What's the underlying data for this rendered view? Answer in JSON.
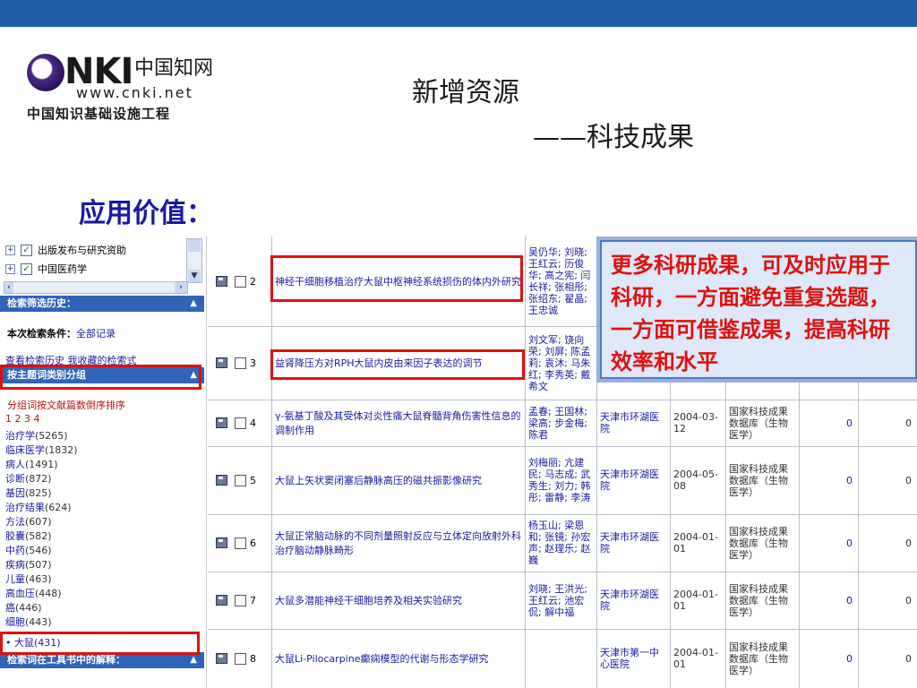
{
  "logo": {
    "brand": "CNKI",
    "cn": "中国知网",
    "url": "www.cnki.net",
    "sub": "中国知识基础设施工程"
  },
  "slide": {
    "title1": "新增资源",
    "title2": "——科技成果",
    "heading": "应用价值：",
    "callout": "更多科研成果，可及时应用于科研，一方面避免重复选题，一方面可借鉴成果，提高科研效率和水平"
  },
  "sidebar": {
    "tree": [
      {
        "label": "出版发布与研究资助"
      },
      {
        "label": "中国医药学"
      }
    ],
    "history_bar": "检索筛选历史：",
    "cond_label": "本次检索条件：",
    "cond_value": "全部记录",
    "history_links": "查看检索历史  我收藏的检索式",
    "group_bar": "按主题词类别分组",
    "sort_text": "分组词按文献篇数倒序排序",
    "pages": "1 2 3 4",
    "topics": [
      {
        "name": "治疗学",
        "count": "(5265)"
      },
      {
        "name": "临床医学",
        "count": "(1832)"
      },
      {
        "name": "病人",
        "count": "(1491)"
      },
      {
        "name": "诊断",
        "count": "(872)"
      },
      {
        "name": "基因",
        "count": "(825)"
      },
      {
        "name": "治疗结果",
        "count": "(624)"
      },
      {
        "name": "方法",
        "count": "(607)"
      },
      {
        "name": "胶囊",
        "count": "(582)"
      },
      {
        "name": "中药",
        "count": "(546)"
      },
      {
        "name": "疾病",
        "count": "(507)"
      },
      {
        "name": "儿童",
        "count": "(463)"
      },
      {
        "name": "高血压",
        "count": "(448)"
      },
      {
        "name": "癌",
        "count": "(446)"
      },
      {
        "name": "细胞",
        "count": "(443)"
      }
    ],
    "selected_topic": "• 大鼠(431)",
    "bottom_bar": "检索词在工具书中的解释："
  },
  "table": {
    "rows": [
      {
        "idx": "2",
        "title": "神经干细胞移植治疗大鼠中枢神经系统损伤的体内外研究",
        "authors": "吴仍华; 刘晓; 王红云; 历俊华; 高之宪; 闫长祥; 张相彤; 张绍东; 翟晶; 王忠诚",
        "org": "",
        "date": "",
        "db": "",
        "n1": "",
        "n2": ""
      },
      {
        "idx": "3",
        "title": "益肾降压方对RPH大鼠内皮由来因子表达的调节",
        "authors": "刘文军; 饶向荣; 刘屏; 陈孟莉; 袁沐; 马朱红; 李秀英; 戴希文",
        "org": "",
        "date": "",
        "db": "",
        "n1": "",
        "n2": ""
      },
      {
        "idx": "4",
        "title": "γ-氨基丁酸及其受体对炎性痛大鼠脊髓背角伤害性信息的调制作用",
        "authors": "孟春; 王国林; 梁高; 步金梅; 陈君",
        "org": "天津市环湖医院",
        "date": "2004-03-12",
        "db": "国家科技成果数据库（生物医学）",
        "n1": "0",
        "n2": "0"
      },
      {
        "idx": "5",
        "title": "大鼠上矢状窦闭塞后静脉高压的磁共振影像研究",
        "authors": "刘梅丽; 亢建民; 马志成; 武秀生; 刘力; 韩彤; 雷静; 李涛",
        "org": "天津市环湖医院",
        "date": "2004-05-08",
        "db": "国家科技成果数据库（生物医学）",
        "n1": "0",
        "n2": "0"
      },
      {
        "idx": "6",
        "title": "大鼠正常脑动脉的不同剂量照射反应与立体定向放射外科治疗脑动静脉畸形",
        "authors": "杨玉山; 梁恩和; 张镜; 孙宏声; 赵理乐; 赵巍",
        "org": "天津市环湖医院",
        "date": "2004-01-01",
        "db": "国家科技成果数据库（生物医学）",
        "n1": "0",
        "n2": "0"
      },
      {
        "idx": "7",
        "title": "大鼠多潜能神经干细胞培养及相关实验研究",
        "authors": "刘晓; 王洪光; 王红云; 池宏侃; 解中福",
        "org": "天津市环湖医院",
        "date": "2004-01-01",
        "db": "国家科技成果数据库（生物医学）",
        "n1": "0",
        "n2": "0"
      },
      {
        "idx": "8",
        "title": "大鼠Li-Pilocarpine癫痫模型的代谢与形态学研究",
        "authors": "",
        "org": "天津市第一中心医院",
        "date": "2004-01-01",
        "db": "国家科技成果数据库（生物医学）",
        "n1": "0",
        "n2": "0"
      }
    ]
  }
}
